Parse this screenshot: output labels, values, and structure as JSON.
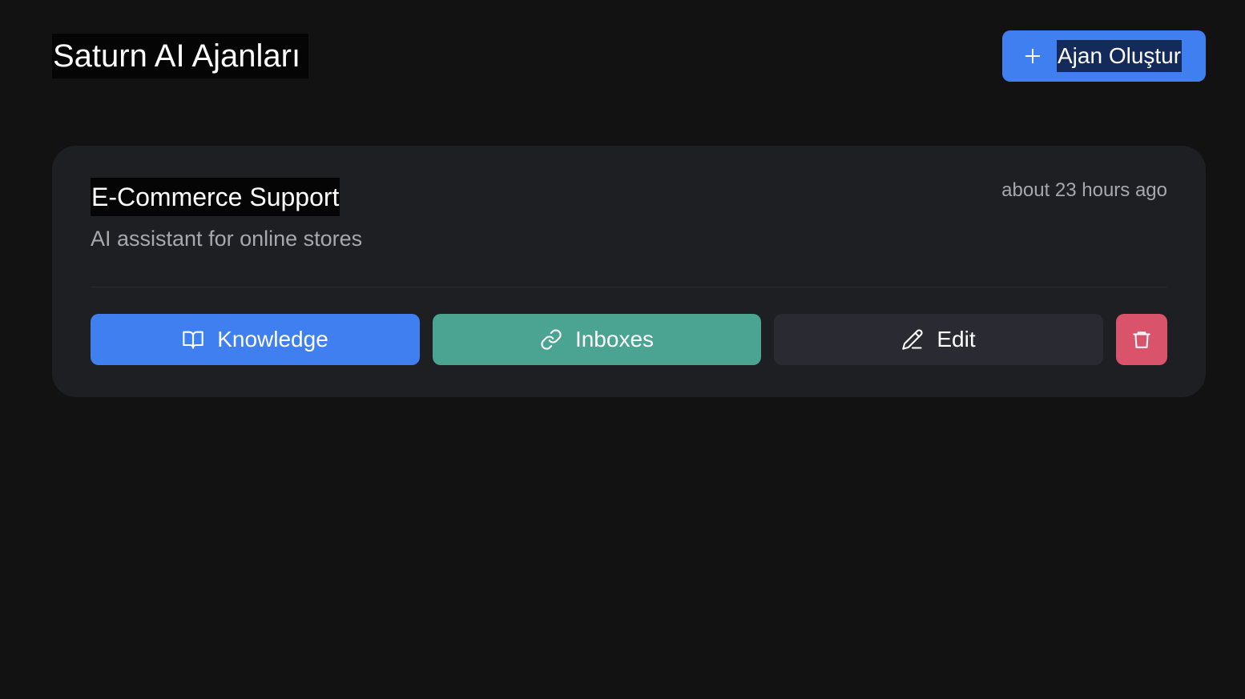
{
  "header": {
    "title": "Saturn AI Ajanları",
    "create_button_label": "Ajan Oluştur",
    "create_button_icon": "plus-icon"
  },
  "agents": [
    {
      "name": "E-Commerce Support",
      "description": "AI assistant for online stores",
      "updated": "about 23 hours ago",
      "actions": {
        "knowledge_label": "Knowledge",
        "knowledge_icon": "book-open-icon",
        "inboxes_label": "Inboxes",
        "inboxes_icon": "link-icon",
        "edit_label": "Edit",
        "edit_icon": "pencil-icon",
        "delete_icon": "trash-icon"
      }
    }
  ],
  "colors": {
    "background": "#121213",
    "card": "#1e1f23",
    "primary": "#3f7ff0",
    "teal": "#4ba391",
    "neutral_button": "#2a2b32",
    "danger": "#d9536a",
    "muted_text": "#a7a8ae"
  }
}
